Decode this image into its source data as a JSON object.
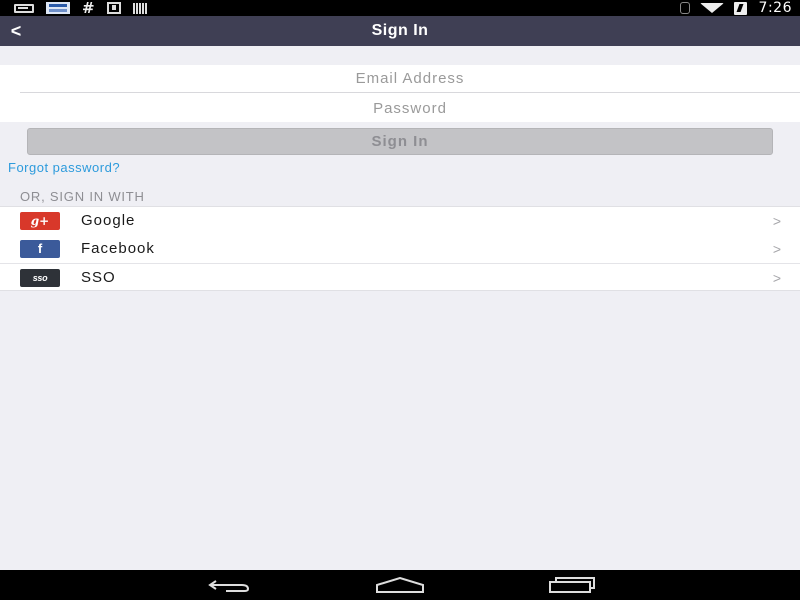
{
  "status_bar": {
    "time": "7:26",
    "icons": [
      "message-icon",
      "news-icon",
      "hashtag-icon",
      "download-icon",
      "barcode-icon",
      "bluetooth-icon",
      "wifi-icon",
      "battery-charging-icon"
    ]
  },
  "nav": {
    "back_label": "<",
    "title": "Sign In"
  },
  "form": {
    "email_placeholder": "Email Address",
    "email_value": "",
    "password_placeholder": "Password",
    "password_value": ""
  },
  "signin_button": "Sign In",
  "forgot_password": "Forgot password?",
  "section_header": "OR, SIGN IN WITH",
  "providers": [
    {
      "label": "Google",
      "logo_text": "g+",
      "icon": "google-plus-icon",
      "color": "#d8382a"
    },
    {
      "label": "Facebook",
      "logo_text": "f",
      "icon": "facebook-icon",
      "color": "#3b5a9a"
    },
    {
      "label": "SSO",
      "logo_text": "sso",
      "icon": "sso-icon",
      "color": "#2e3238"
    }
  ],
  "chevron": ">",
  "colors": {
    "nav_bar": "#3f3f54",
    "link": "#2d9bdc",
    "background": "#efeff4"
  }
}
